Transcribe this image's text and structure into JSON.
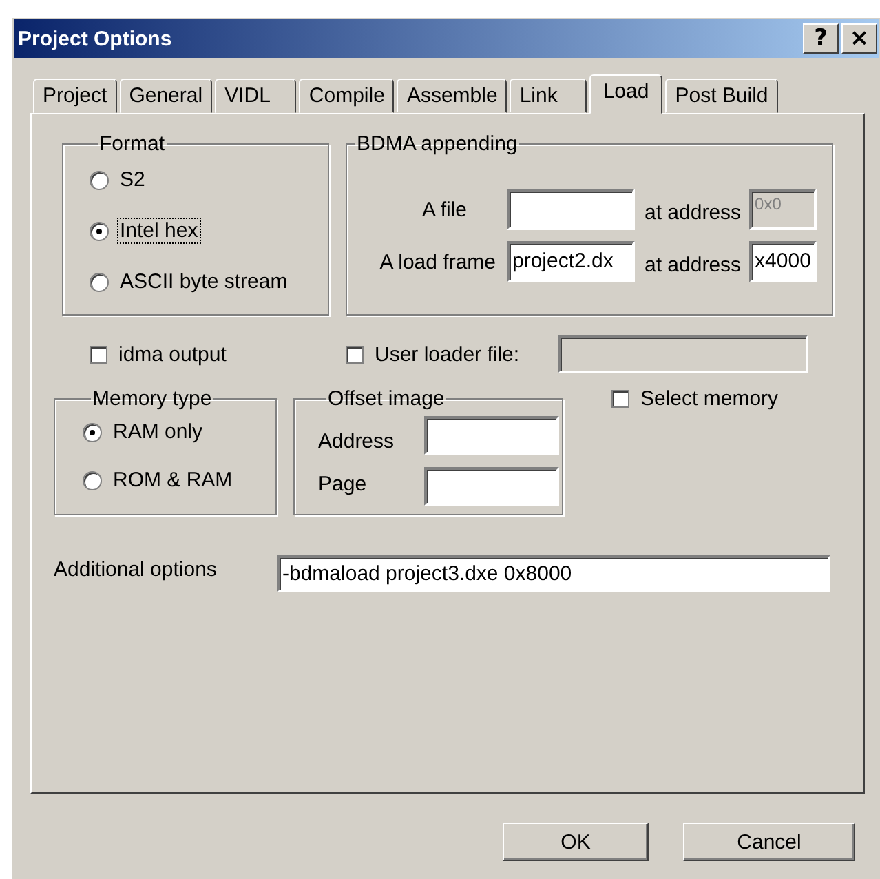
{
  "window": {
    "title": "Project Options",
    "help_button": "?",
    "close_button": "×"
  },
  "tabs": [
    {
      "label": "Project",
      "selected": false
    },
    {
      "label": "General",
      "selected": false
    },
    {
      "label": "VIDL",
      "selected": false
    },
    {
      "label": "Compile",
      "selected": false
    },
    {
      "label": "Assemble",
      "selected": false
    },
    {
      "label": "Link",
      "selected": false
    },
    {
      "label": "Load",
      "selected": true
    },
    {
      "label": "Post Build",
      "selected": false
    }
  ],
  "format": {
    "title": "Format",
    "options": [
      {
        "label": "S2",
        "selected": false,
        "focused": false
      },
      {
        "label": "Intel hex",
        "selected": true,
        "focused": true
      },
      {
        "label": "ASCII byte stream",
        "selected": false,
        "focused": false
      }
    ]
  },
  "bdma_appending": {
    "title": "BDMA appending",
    "rows": [
      {
        "label": "A file",
        "address_label": "at address",
        "address": "0x0",
        "address_disabled": true
      },
      {
        "label": "A load frame",
        "value": "project2.dx",
        "address_label": "at address",
        "address": "x4000",
        "address_disabled": false
      }
    ]
  },
  "idma_output": {
    "label": "idma output",
    "checked": false
  },
  "user_loader_file": {
    "label": "User loader file:",
    "checked": false,
    "field_disabled": true
  },
  "memory_type": {
    "title": "Memory type",
    "options": [
      {
        "label": "RAM only",
        "selected": true
      },
      {
        "label": "ROM & RAM",
        "selected": false
      }
    ]
  },
  "offset_image": {
    "title": "Offset image",
    "fields": [
      {
        "label": "Address"
      },
      {
        "label": "Page"
      }
    ]
  },
  "select_memory": {
    "label": "Select memory",
    "checked": false
  },
  "additional_options": {
    "label": "Additional options",
    "value": "-bdmaload project3.dxe 0x8000"
  },
  "buttons": [
    {
      "label": "OK"
    },
    {
      "label": "Cancel"
    }
  ]
}
